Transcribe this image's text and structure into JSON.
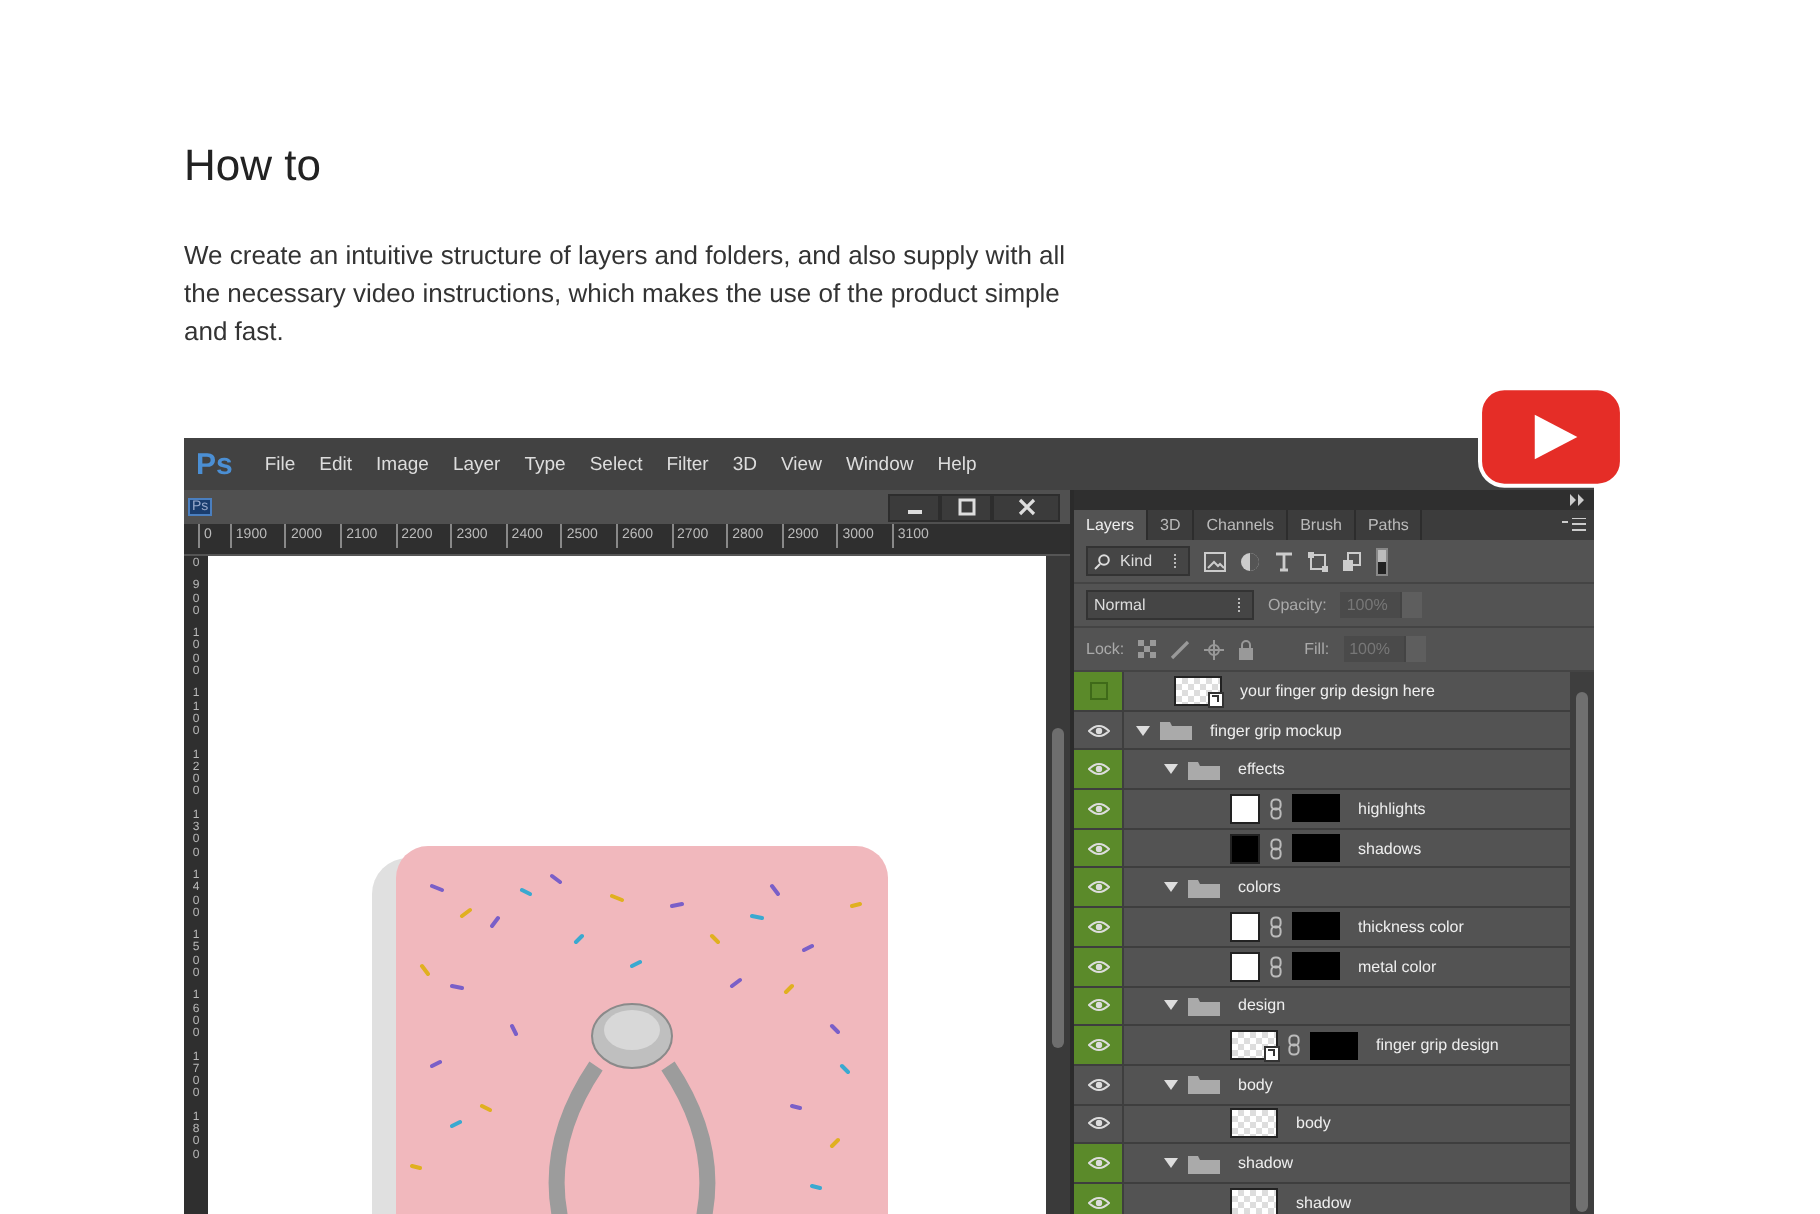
{
  "heading": "How to",
  "description": "We create an intuitive structure of layers and folders, and also supply with all the necessary video instructions, which makes the use of the product simple and fast.",
  "app": {
    "logo": "Ps",
    "menu": [
      "File",
      "Edit",
      "Image",
      "Layer",
      "Type",
      "Select",
      "Filter",
      "3D",
      "View",
      "Window",
      "Help"
    ],
    "document": {
      "badge": "Ps",
      "h_ruler": [
        "0",
        "1900",
        "2000",
        "2100",
        "2200",
        "2300",
        "2400",
        "2500",
        "2600",
        "2700",
        "2800",
        "2900",
        "3000",
        "3100"
      ],
      "v_ruler": [
        "0",
        "900",
        "1000",
        "1100",
        "1200",
        "1300",
        "1400",
        "1500",
        "1600",
        "1700",
        "1800"
      ]
    },
    "layers_panel": {
      "tabs": [
        {
          "label": "Layers",
          "selected": true
        },
        {
          "label": "3D",
          "selected": false
        },
        {
          "label": "Channels",
          "selected": false
        },
        {
          "label": "Brush",
          "selected": false
        },
        {
          "label": "Paths",
          "selected": false
        }
      ],
      "filter": "Kind",
      "blend_mode": "Normal",
      "opacity_label": "Opacity:",
      "opacity": "100%",
      "lock_label": "Lock:",
      "fill_label": "Fill:",
      "fill": "100%",
      "layers": [
        {
          "kind": "smart_object",
          "name": "your finger grip design here",
          "visible": false,
          "color": "#5b8a2a",
          "mask": false
        },
        {
          "kind": "folder",
          "name": "finger grip mockup",
          "visible": true,
          "color": "#535353",
          "expanded": true,
          "children": [
            {
              "kind": "folder",
              "name": "effects",
              "visible": true,
              "color": "#5b8a2a",
              "expanded": true,
              "children": [
                {
                  "kind": "fill_layer",
                  "name": "highlights",
                  "visible": true,
                  "color": "#5b8a2a",
                  "dark_fill": false,
                  "mask": true
                },
                {
                  "kind": "fill_layer",
                  "name": "shadows",
                  "visible": true,
                  "color": "#5b8a2a",
                  "dark_fill": true,
                  "mask": true
                }
              ]
            },
            {
              "kind": "folder",
              "name": "colors",
              "visible": true,
              "color": "#5b8a2a",
              "expanded": true,
              "children": [
                {
                  "kind": "fill_layer",
                  "name": "thickness color",
                  "visible": true,
                  "color": "#5b8a2a",
                  "dark_fill": false,
                  "mask": true
                },
                {
                  "kind": "fill_layer",
                  "name": "metal color",
                  "visible": true,
                  "color": "#5b8a2a",
                  "dark_fill": false,
                  "mask": true
                }
              ]
            },
            {
              "kind": "folder",
              "name": "design",
              "visible": true,
              "color": "#5b8a2a",
              "expanded": true,
              "children": [
                {
                  "kind": "smart_object",
                  "name": "finger grip design",
                  "visible": true,
                  "color": "#5b8a2a",
                  "mask": true
                }
              ]
            },
            {
              "kind": "folder",
              "name": "body",
              "visible": true,
              "color": "#535353",
              "expanded": true,
              "children": [
                {
                  "kind": "pixel_layer",
                  "name": "body",
                  "visible": true,
                  "color": "#535353",
                  "mask": false
                }
              ]
            },
            {
              "kind": "folder",
              "name": "shadow",
              "visible": true,
              "color": "#5b8a2a",
              "expanded": true,
              "children": [
                {
                  "kind": "pixel_layer",
                  "name": "shadow",
                  "visible": true,
                  "color": "#5b8a2a",
                  "mask": false
                }
              ]
            }
          ]
        }
      ]
    }
  }
}
